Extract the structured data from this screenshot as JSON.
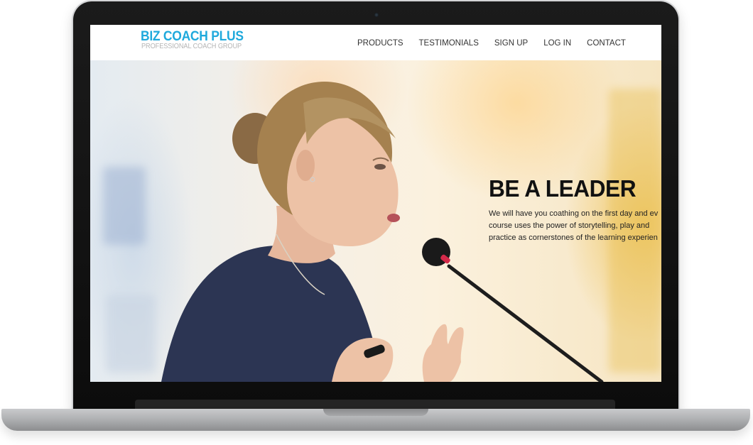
{
  "brand": {
    "title": "BIZ COACH PLUS",
    "subtitle": "PROFESSIONAL COACH GROUP",
    "accent_color": "#1fa9dc"
  },
  "nav": {
    "items": [
      "PRODUCTS",
      "TESTIMONIALS",
      "SIGN UP",
      "LOG IN",
      "CONTACT"
    ]
  },
  "hero": {
    "title": "BE A LEADER",
    "body": "We will have you coathing on the first day and ev\ncourse uses the power of storytelling, play and\npractice as cornerstones of the learning experien",
    "image": "woman-speaking-into-microphone"
  }
}
